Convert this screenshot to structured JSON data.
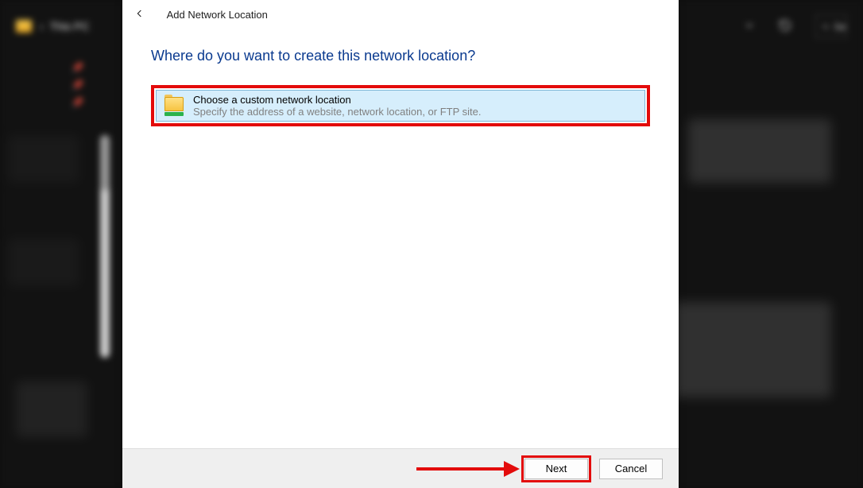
{
  "explorer": {
    "breadcrumb_sep": "›",
    "breadcrumb_location": "This PC",
    "search_placeholder": "Se"
  },
  "dialog": {
    "title": "Add Network Location",
    "heading": "Where do you want to create this network location?",
    "option": {
      "title": "Choose a custom network location",
      "subtitle": "Specify the address of a website, network location, or FTP site."
    },
    "buttons": {
      "next": "Next",
      "cancel": "Cancel"
    }
  }
}
